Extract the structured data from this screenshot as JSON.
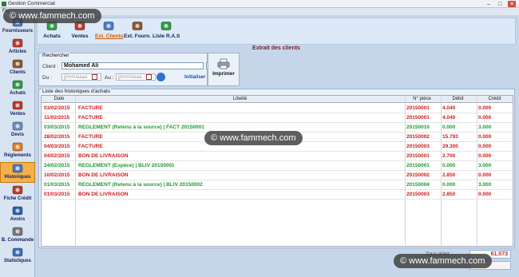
{
  "window": {
    "title": "Gestion Commercial",
    "menu_first": "Fic"
  },
  "watermark": "© www.fammech.com",
  "sidebar": [
    {
      "label": "Fournisseurs",
      "icon": "suppliers-icon",
      "color": "#4a7bd0"
    },
    {
      "label": "Articles",
      "icon": "articles-icon",
      "color": "#c0392b"
    },
    {
      "label": "Clients",
      "icon": "clients-icon",
      "color": "#8e5b2b"
    },
    {
      "label": "Achats",
      "icon": "purchases-icon",
      "color": "#2e9e44"
    },
    {
      "label": "Ventes",
      "icon": "sales-icon",
      "color": "#c0392b"
    },
    {
      "label": "Devis",
      "icon": "quote-icon",
      "color": "#6a8fc7"
    },
    {
      "label": "Réglements",
      "icon": "payments-icon",
      "color": "#e67e22"
    },
    {
      "label": "Historiques",
      "icon": "history-icon",
      "color": "#4a7bd0"
    },
    {
      "label": "Fiche Crédit",
      "icon": "credit-icon",
      "color": "#c0392b"
    },
    {
      "label": "Avoirs",
      "icon": "refund-icon",
      "color": "#2c5fb0"
    },
    {
      "label": "B. Commande",
      "icon": "order-icon",
      "color": "#777777"
    },
    {
      "label": "Statistiques",
      "icon": "stats-icon",
      "color": "#3b6fc4"
    }
  ],
  "toolbar": [
    {
      "label": "Achats",
      "icon": "purchases-icon",
      "color": "#2e9e44"
    },
    {
      "label": "Ventes",
      "icon": "sales-icon",
      "color": "#c0392b"
    },
    {
      "label": "Ext. Clients",
      "icon": "client-extract-icon",
      "color": "#4a7bd0"
    },
    {
      "label": "Ext. Fourn.",
      "icon": "supplier-extract-icon",
      "color": "#8e5b2b"
    },
    {
      "label": "Liste R.A.S",
      "icon": "ras-list-icon",
      "color": "#2e9e44"
    }
  ],
  "panel_title": "Extrait des clients",
  "search": {
    "legend": "Rechercher",
    "client_label": "Client :",
    "client_value": "Mohamed Ali",
    "browse_label": "...",
    "du_label": "Du :",
    "au_label": "Au :",
    "date_placeholder": "jj/mm/aaaa",
    "reset_label": "Initialiser"
  },
  "print_label": "Imprimer",
  "list": {
    "legend": "Liste des historiques d'achats",
    "columns": [
      "Date",
      "Libellé",
      "N° pièce",
      "Débit",
      "Crédit"
    ],
    "rows": [
      {
        "date": "03/02/2015",
        "libelle": "FACTURE",
        "piece": "20150001",
        "debit": "4.040",
        "credit": "0.000",
        "color": "#d11a1a"
      },
      {
        "date": "11/02/2015",
        "libelle": "FACTURE",
        "piece": "20150001",
        "debit": "4.040",
        "credit": "0.000",
        "color": "#d11a1a"
      },
      {
        "date": "03/03/2015",
        "libelle": "REGLEMENT (Retenu à la source) | FACT 20150001",
        "piece": "20150010",
        "debit": "0.000",
        "credit": "3.000",
        "color": "#1f9a2e"
      },
      {
        "date": "28/02/2015",
        "libelle": "FACTURE",
        "piece": "20150002",
        "debit": "15.793",
        "credit": "0.000",
        "color": "#d11a1a"
      },
      {
        "date": "04/03/2015",
        "libelle": "FACTURE",
        "piece": "20150003",
        "debit": "29.300",
        "credit": "0.000",
        "color": "#d11a1a"
      },
      {
        "date": "04/02/2015",
        "libelle": "BON DE LIVRAISON",
        "piece": "20150001",
        "debit": "2.700",
        "credit": "0.000",
        "color": "#d11a1a"
      },
      {
        "date": "24/02/2015",
        "libelle": "REGLEMENT (Espèce) | BLIV 20150001",
        "piece": "20150001",
        "debit": "0.000",
        "credit": "3.000",
        "color": "#1f9a2e"
      },
      {
        "date": "10/02/2015",
        "libelle": "BON DE LIVRAISON",
        "piece": "20150002",
        "debit": "2.850",
        "credit": "0.000",
        "color": "#d11a1a"
      },
      {
        "date": "01/03/2015",
        "libelle": "REGLEMENT (Retenu à la source) | BLIV 20150002",
        "piece": "20150004",
        "debit": "0.000",
        "credit": "3.000",
        "color": "#1f9a2e"
      },
      {
        "date": "01/03/2015",
        "libelle": "BON DE LIVRAISON",
        "piece": "20150003",
        "debit": "2.850",
        "credit": "0.000",
        "color": "#d11a1a"
      }
    ]
  },
  "totals": {
    "debit_label": "Total débit :",
    "debit_value": "61.573"
  }
}
